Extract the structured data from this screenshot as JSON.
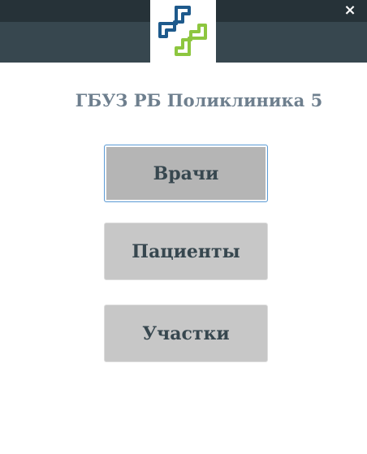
{
  "window": {
    "close_symbol": "×",
    "logo_icon": "medical-cross-logo-icon",
    "colors": {
      "titlebar_top": "#263238",
      "titlebar_bottom": "#37474f",
      "logo_blue": "#1e5a8c",
      "logo_green": "#8dc63f"
    }
  },
  "main": {
    "title": "ГБУЗ РБ Поликлиника 5",
    "buttons": [
      {
        "label": "Врачи"
      },
      {
        "label": "Пациенты"
      },
      {
        "label": "Участки"
      }
    ]
  }
}
